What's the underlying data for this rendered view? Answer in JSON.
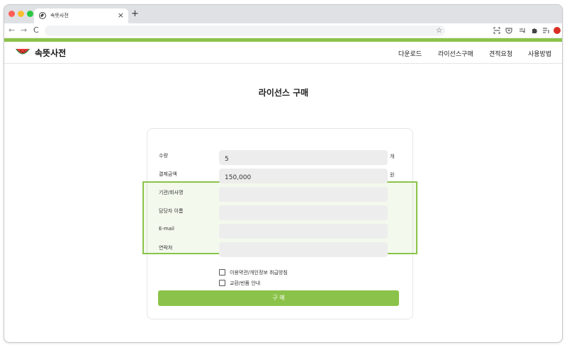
{
  "browser": {
    "tab_title": "속뜻사전",
    "tab_close": "×",
    "new_tab": "+",
    "back": "←",
    "forward": "→",
    "reload": "C",
    "bookmark_star": "☆",
    "profile_color": "#d93025"
  },
  "site": {
    "logo_text": "속뜻사전",
    "nav": [
      "다운로드",
      "라이선스구매",
      "견적요청",
      "사용방법"
    ],
    "accent_color": "#8bc34a"
  },
  "page": {
    "title": "라이선스 구매"
  },
  "form": {
    "quantity": {
      "label": "수량",
      "value": "5",
      "unit": "개"
    },
    "amount": {
      "label": "결제금액",
      "value": "150,000",
      "unit": "원"
    },
    "company": {
      "label": "기관/회사명",
      "value": ""
    },
    "contact_name": {
      "label": "담당자 이름",
      "value": ""
    },
    "email": {
      "label": "E-mail",
      "value": ""
    },
    "phone": {
      "label": "연락처",
      "value": ""
    },
    "checkboxes": [
      {
        "label": "이용약관/개인정보 취급방침",
        "checked": false
      },
      {
        "label": "교환/반품 안내",
        "checked": false
      }
    ],
    "submit_label": "구 매"
  }
}
